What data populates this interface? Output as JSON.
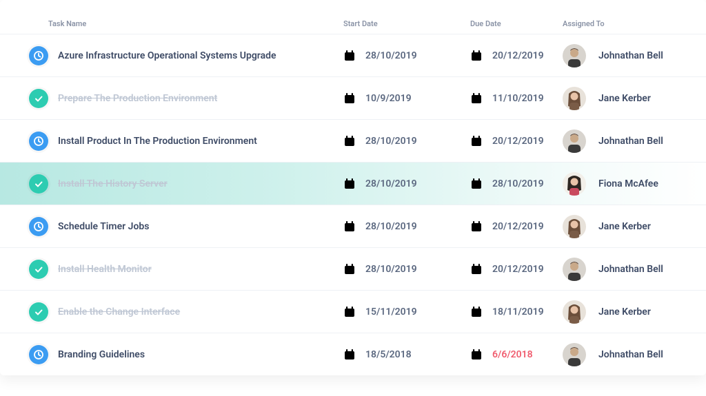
{
  "headers": {
    "task": "Task Name",
    "start": "Start Date",
    "due": "Due Date",
    "assigned": "Assigned To"
  },
  "tasks": [
    {
      "name": "Azure Infrastructure Operational Systems Upgrade",
      "start": "28/10/2019",
      "due": "20/12/2019",
      "assignee": "Johnathan Bell",
      "status": "pending",
      "overdue": false,
      "highlight": false,
      "avatar": "m1"
    },
    {
      "name": "Prepare The Production Environment",
      "start": "10/9/2019",
      "due": "11/10/2019",
      "assignee": "Jane Kerber",
      "status": "done",
      "overdue": false,
      "highlight": false,
      "avatar": "f1"
    },
    {
      "name": "Install Product In The Production Environment",
      "start": "28/10/2019",
      "due": "20/12/2019",
      "assignee": "Johnathan Bell",
      "status": "pending",
      "overdue": false,
      "highlight": false,
      "avatar": "m1"
    },
    {
      "name": "Install The History Server",
      "start": "28/10/2019",
      "due": "28/10/2019",
      "assignee": "Fiona McAfee",
      "status": "done",
      "overdue": false,
      "highlight": true,
      "avatar": "f2"
    },
    {
      "name": "Schedule Timer Jobs",
      "start": "28/10/2019",
      "due": "20/12/2019",
      "assignee": "Jane Kerber",
      "status": "pending",
      "overdue": false,
      "highlight": false,
      "avatar": "f1"
    },
    {
      "name": "Install Health Monitor",
      "start": "28/10/2019",
      "due": "20/12/2019",
      "assignee": "Johnathan Bell",
      "status": "done",
      "overdue": false,
      "highlight": false,
      "avatar": "m1"
    },
    {
      "name": "Enable the Change Interface",
      "start": "15/11/2019",
      "due": "18/11/2019",
      "assignee": "Jane Kerber",
      "status": "done",
      "overdue": false,
      "highlight": false,
      "avatar": "f1"
    },
    {
      "name": "Branding Guidelines",
      "start": "18/5/2018",
      "due": "6/6/2018",
      "assignee": "Johnathan Bell",
      "status": "pending",
      "overdue": true,
      "highlight": false,
      "avatar": "m1"
    }
  ]
}
